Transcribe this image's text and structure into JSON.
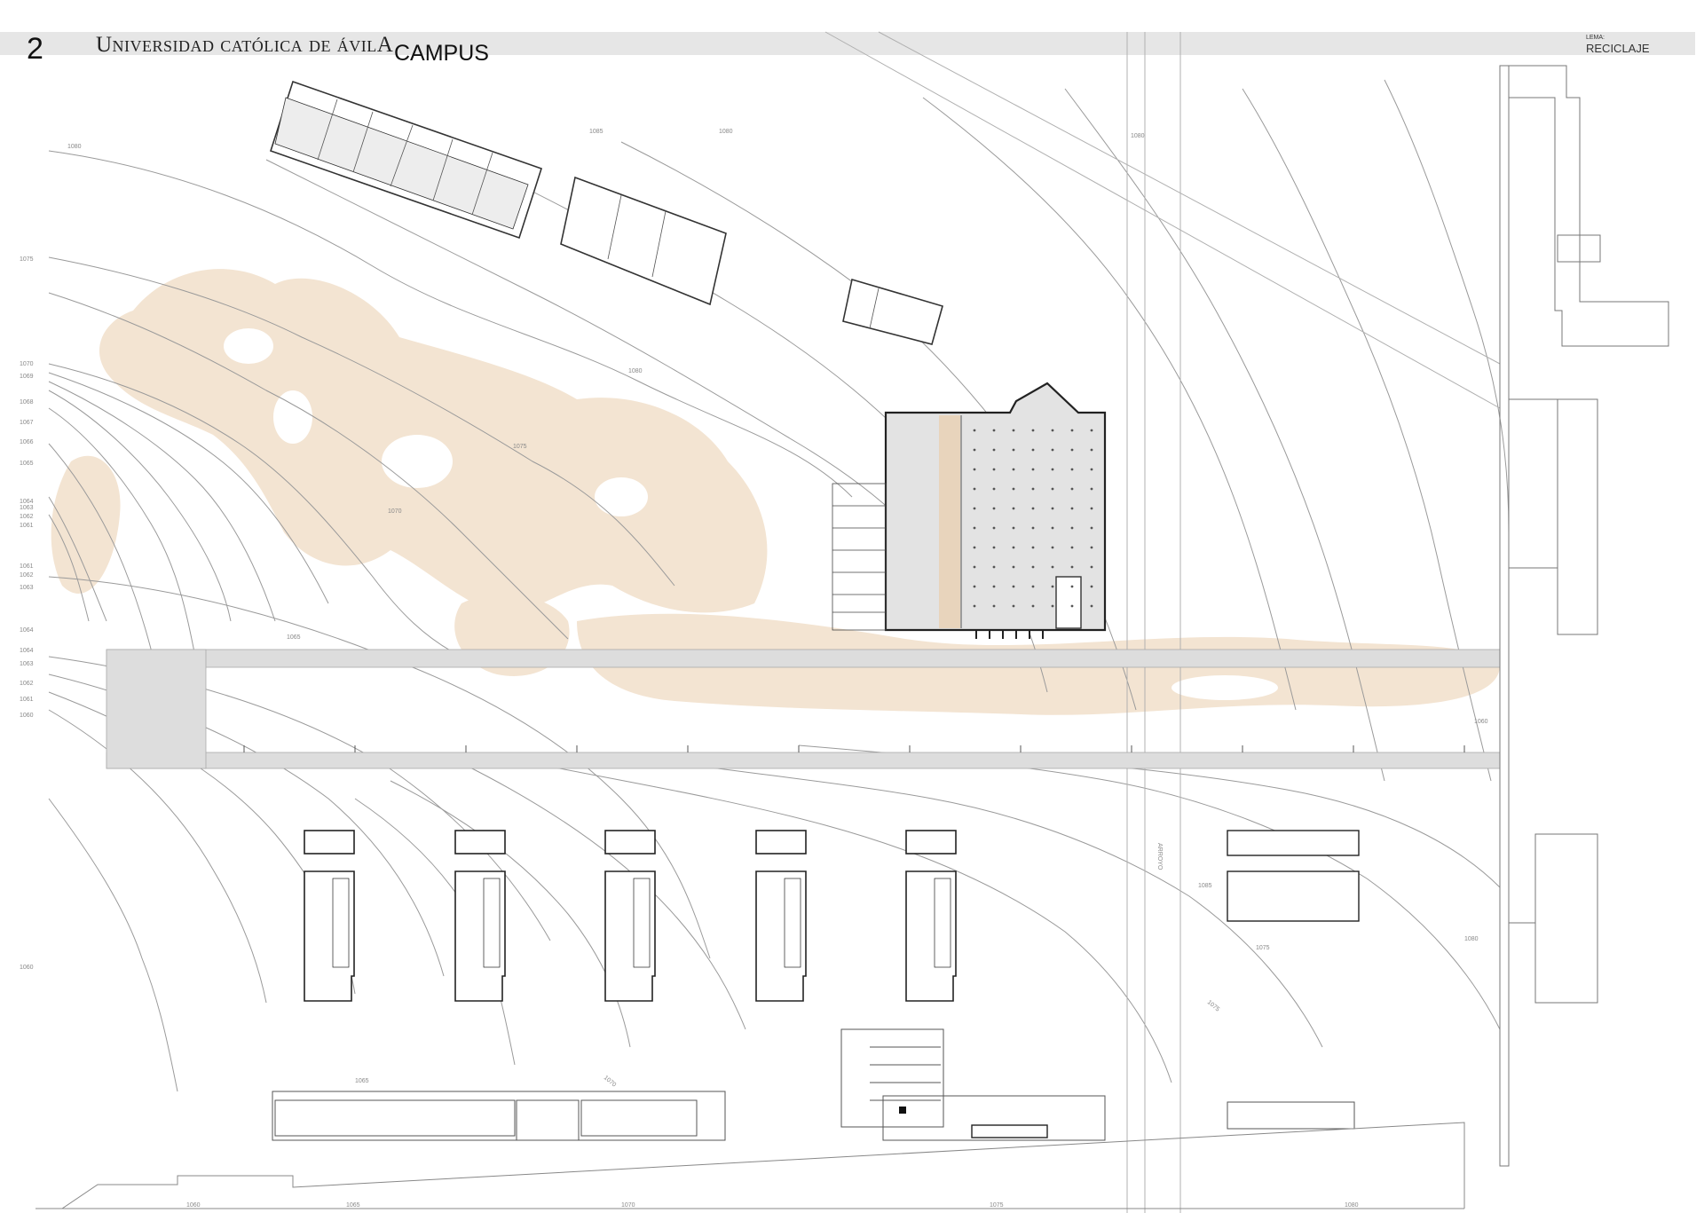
{
  "header": {
    "sheet_number": "2",
    "institution": "Universidad católica de ávilA",
    "section_title": "CAMPUS",
    "lema_label": "LEMA:",
    "lema_value": "RECICLAJE"
  },
  "contour_labels_left": [
    "1075",
    "1070",
    "1069",
    "1068",
    "1067",
    "1066",
    "1065",
    "1064",
    "1063",
    "1062",
    "1061",
    "1061",
    "1062",
    "1063",
    "1064",
    "1064",
    "1063",
    "1062",
    "1061",
    "1060",
    "1060"
  ],
  "contour_labels_plan": [
    "1080",
    "1085",
    "1080",
    "1080",
    "1080",
    "1075",
    "1070",
    "1065",
    "1060",
    "1075",
    "1070",
    "1065",
    "1075",
    "1080",
    "1085"
  ],
  "bottom_axis_labels": [
    "1060",
    "1065",
    "1070",
    "1075",
    "1080"
  ],
  "road_label": "ARROYO",
  "colors": {
    "terrain_fill": "#f3e4d2",
    "building_fill": "#e3e3e3",
    "wood_fill": "#e8d4bc",
    "contour_line": "#9a9a9a",
    "road_band": "#dddddd"
  }
}
